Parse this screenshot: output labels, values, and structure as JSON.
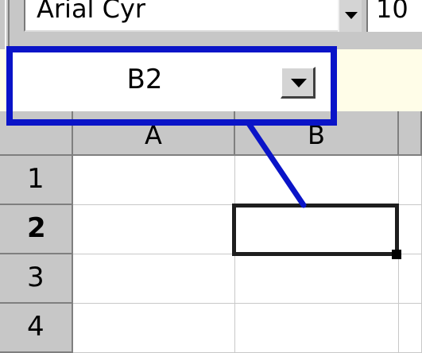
{
  "toolbar": {
    "font_name": "Arial Cyr",
    "font_size": "10",
    "font_dropdown_icon": "triangle-down-icon"
  },
  "name_box": {
    "value": "B2",
    "dropdown_icon": "triangle-down-icon"
  },
  "grid": {
    "columns": [
      "A",
      "B"
    ],
    "rows": [
      "1",
      "2",
      "3",
      "4"
    ],
    "active_cell": "B2"
  },
  "annotation": {
    "color": "#0a14c8",
    "target": "name_box"
  }
}
